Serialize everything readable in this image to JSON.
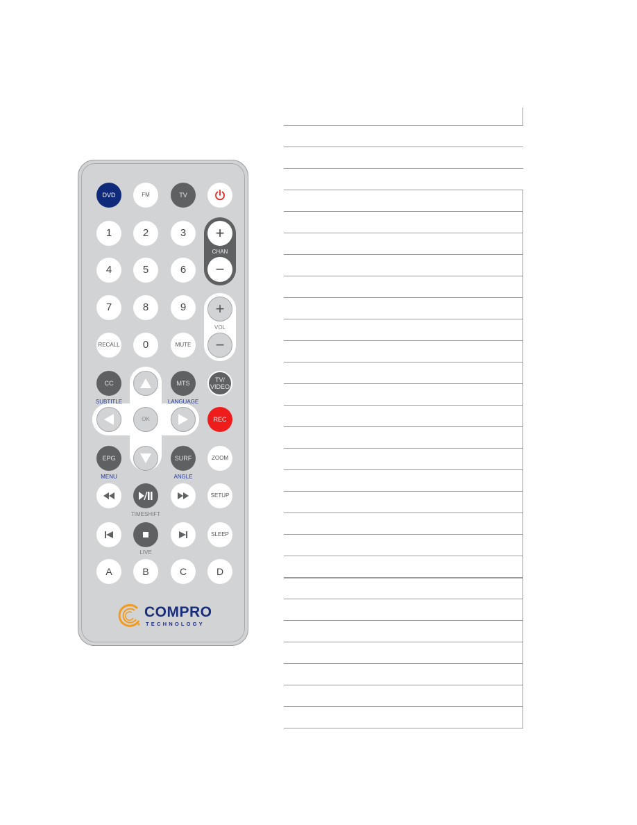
{
  "remote": {
    "brand": {
      "name": "COMPRO",
      "sub": "TECHNOLOGY",
      "colors": {
        "swirl": "#f39a1e",
        "text": "#1a2d7a"
      }
    },
    "buttons": {
      "dvd": "DVD",
      "fm": "FM",
      "tv": "TV",
      "power_icon": "power-icon",
      "n1": "1",
      "n2": "2",
      "n3": "3",
      "n4": "4",
      "n5": "5",
      "n6": "6",
      "n7": "7",
      "n8": "8",
      "n9": "9",
      "recall": "RECALL",
      "n0": "0",
      "mute": "MUTE",
      "chan_plus": "+",
      "chan_minus": "−",
      "chan_label": "CHAN",
      "vol_plus": "+",
      "vol_minus": "−",
      "vol_label": "VOL",
      "cc": "CC",
      "mts": "MTS",
      "tv_video": "TV/ VIDEO",
      "ok": "OK",
      "rec": "REC",
      "epg": "EPG",
      "surf": "SURF",
      "zoom": "ZOOM",
      "setup": "SETUP",
      "sleep": "SLEEP",
      "a": "A",
      "b": "B",
      "c": "C",
      "d": "D"
    },
    "labels": {
      "subtitle": "SUBTITLE",
      "language": "LANGUAGE",
      "menu": "MENU",
      "angle": "ANGLE",
      "timeshift": "TIMESHIFT",
      "live": "LIVE"
    },
    "colors": {
      "navy": "#0f2a7a",
      "red": "#ef1c1c",
      "dark": "#5f6062",
      "body": "#d2d3d5"
    }
  },
  "table": {
    "row_count": 29,
    "rows": [
      "",
      "",
      "",
      "",
      "",
      "",
      "",
      "",
      "",
      "",
      "",
      "",
      "",
      "",
      "",
      "",
      "",
      "",
      "",
      "",
      "",
      "",
      "",
      "",
      "",
      "",
      "",
      "",
      ""
    ]
  }
}
